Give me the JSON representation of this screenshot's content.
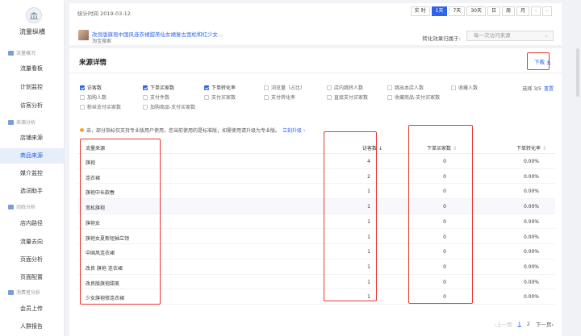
{
  "sidebar": {
    "title": "流量纵横",
    "groups": [
      {
        "label": "流量概况",
        "items": [
          "流量看板",
          "计划监控",
          "访客分析"
        ]
      },
      {
        "label": "来源分析",
        "items": [
          "店铺来源",
          "商品来源",
          "媒介监控",
          "选词助手"
        ]
      },
      {
        "label": "动线分析",
        "items": [
          "店内路径",
          "流量去向",
          "页面分析",
          "页面配置"
        ]
      },
      {
        "label": "消费者分析",
        "items": [
          "会员上传",
          "人群报告"
        ]
      }
    ],
    "active_item": "商品来源"
  },
  "topbar": {
    "stat_time": "统计时间 2019-03-12",
    "time_buttons": [
      "实 时",
      "1天",
      "7天",
      "30天",
      "日",
      "周",
      "月"
    ],
    "active_time": "1天",
    "prev_arrow": "‹",
    "next_arrow": "›",
    "product_title": "改良版旗袍中国风连衣裙甜美仙女裙复古宽松和红少女...",
    "product_sub": "淘宝搜索",
    "attr_label": "转化效果归属于:",
    "attr_value": "每一次访问来源",
    "attr_chev": "⌄"
  },
  "detail": {
    "title": "来源详情",
    "download": "下载",
    "metrics": [
      {
        "label": "访客数",
        "checked": true
      },
      {
        "label": "下单买家数",
        "checked": true
      },
      {
        "label": "下单转化率",
        "checked": true
      },
      {
        "label": "浏览量（占比）",
        "checked": false
      },
      {
        "label": "店内跳转人数",
        "checked": false
      },
      {
        "label": "跳出本店人数",
        "checked": false
      },
      {
        "label": "收藏人数",
        "checked": false
      },
      {
        "label": "加购人数",
        "checked": false
      },
      {
        "label": "支付件数",
        "checked": false
      },
      {
        "label": "支付买家数",
        "checked": false
      },
      {
        "label": "支付转化率",
        "checked": false
      },
      {
        "label": "直接支付买家数",
        "checked": false
      },
      {
        "label": "收藏商品-支付买家数",
        "checked": false
      },
      {
        "label": "粉丝支付买家数",
        "checked": false
      },
      {
        "label": "加购商品-支付买家数",
        "checked": false
      }
    ],
    "select_count": "选择 3/5",
    "reset": "重置",
    "notice": "亲，部分指标仅支持专业版用户使用，您当前使用的是标准版，如需使用请升级为专业版。",
    "upgrade": "立刻升级 ›",
    "columns": {
      "source": "流量来源",
      "visitors": "访客数",
      "orders": "下单买家数",
      "conversion": "下单转化率"
    },
    "sort_desc": "↓",
    "sort_neutral": "⇕",
    "rows": [
      {
        "source": "旗袍",
        "visitors": "4",
        "orders": "0",
        "conversion": "0.00%"
      },
      {
        "source": "连衣裙",
        "visitors": "2",
        "orders": "0",
        "conversion": "0.00%"
      },
      {
        "source": "旗袍中长款春",
        "visitors": "1",
        "orders": "0",
        "conversion": "0.00%"
      },
      {
        "source": "宽松旗袍",
        "visitors": "1",
        "orders": "0",
        "conversion": "0.00%"
      },
      {
        "source": "旗袍女",
        "visitors": "1",
        "orders": "0",
        "conversion": "0.00%"
      },
      {
        "source": "旗袍女夏新短袖立领",
        "visitors": "1",
        "orders": "0",
        "conversion": "0.00%"
      },
      {
        "source": "中国风连衣裙",
        "visitors": "1",
        "orders": "0",
        "conversion": "0.00%"
      },
      {
        "source": "改良 旗袍 连衣裙",
        "visitors": "1",
        "orders": "0",
        "conversion": "0.00%"
      },
      {
        "source": "改良版旗袍甜美",
        "visitors": "1",
        "orders": "0",
        "conversion": "0.00%"
      },
      {
        "source": "少女旗袍修连衣裙",
        "visitors": "1",
        "orders": "0",
        "conversion": "0.00%"
      }
    ],
    "pager": {
      "prev": "‹上一页",
      "pages": [
        "1",
        "2"
      ],
      "current": "1",
      "next": "下一页›"
    }
  },
  "colors": {
    "accent": "#2e63ea",
    "highlight": "#e53935"
  }
}
